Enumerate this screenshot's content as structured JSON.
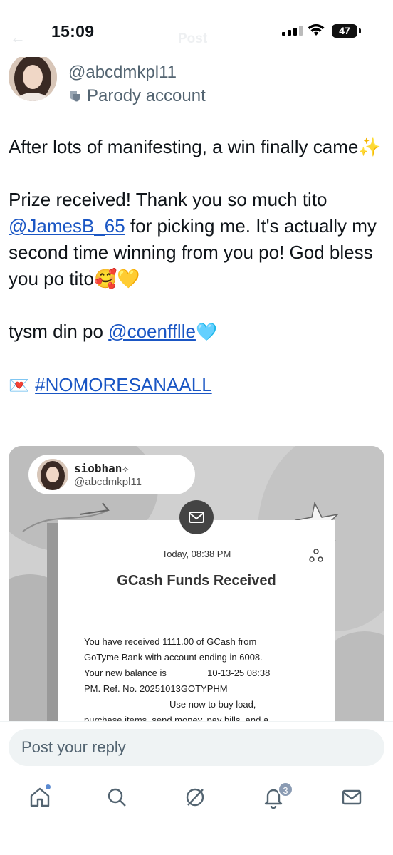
{
  "status_bar": {
    "time": "15:09",
    "battery": "47"
  },
  "header": {
    "back_glyph": "←",
    "title": "Post"
  },
  "author": {
    "handle": "@abcdmkpl11",
    "label": "Parody account"
  },
  "tweet": {
    "p1": "After lots of manifesting, a win finally came✨",
    "p2_a": "Prize received! Thank you so much tito ",
    "p2_mention": "@JamesB_65",
    "p2_b": " for picking me. It's actually my second time winning from you po! God bless you po tito🥰💛",
    "p3_a": "tysm din po ",
    "p3_mention": "@coenfflle",
    "p3_emoji": "🩵",
    "p4_emoji": "💌",
    "p4_hashtag": "#NOMORESANAALL"
  },
  "media": {
    "name": "siobhan✧",
    "handle": "@abcdmkpl11",
    "date": "Today, 08:38 PM",
    "title": "GCash Funds Received",
    "line1": "You have received 1111.00 of GCash from",
    "line2": "GoTyme Bank with account ending in 6008.",
    "line3a": "Your new balance is ",
    "line3b": " 10-13-25 08:38",
    "line4": "PM. Ref. No. 20251013GOTYPHM",
    "line5": "Use now to buy load,",
    "line6": "purchase items, send money, pay bills, and a"
  },
  "reply": {
    "placeholder": "Post your reply"
  },
  "tabbar": {
    "notifications_badge": "3"
  },
  "colors": {
    "link": "#1a56c4",
    "secondary_text": "#536471",
    "badge": "#8a9bb3"
  }
}
